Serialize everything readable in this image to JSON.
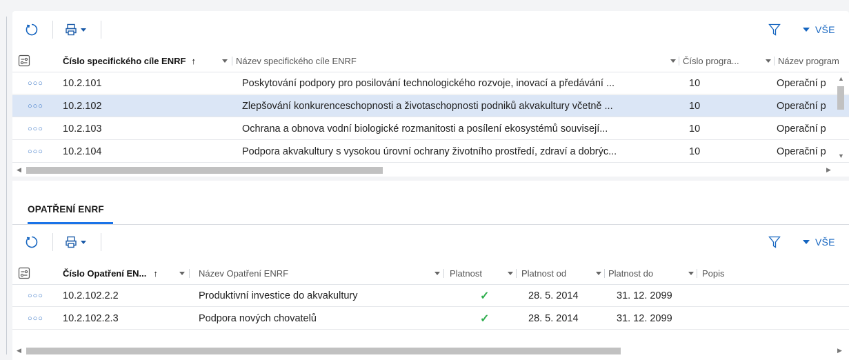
{
  "top_grid": {
    "toolbar": {
      "all_label": "VŠE"
    },
    "columns": [
      {
        "label": "Číslo specifického cíle ENRF",
        "sort_indicator": "↑"
      },
      {
        "label": "Název specifického cíle ENRF"
      },
      {
        "label": "Číslo progra..."
      },
      {
        "label": "Název program"
      }
    ],
    "rows": [
      {
        "code": "10.2.101",
        "name": "Poskytování podpory pro posilování technologického rozvoje, inovací a předávání ...",
        "program": "10",
        "program_name": "Operační p"
      },
      {
        "code": "10.2.102",
        "name": "Zlepšování konkurenceschopnosti a životaschopnosti podniků akvakultury včetně ...",
        "program": "10",
        "program_name": "Operační p",
        "selected": true
      },
      {
        "code": "10.2.103",
        "name": "Ochrana a obnova vodní biologické rozmanitosti a posílení ekosystémů souvisejí...",
        "program": "10",
        "program_name": "Operační p"
      },
      {
        "code": "10.2.104",
        "name": "Podpora akvakultury s vysokou úrovní ochrany životního prostředí, zdraví a dobrýc...",
        "program": "10",
        "program_name": "Operační p"
      }
    ]
  },
  "bottom_panel": {
    "tab_label": "OPATŘENÍ ENRF",
    "toolbar": {
      "all_label": "VŠE"
    },
    "columns": [
      {
        "label": "Číslo Opatření EN...",
        "sort_indicator": "↑"
      },
      {
        "label": "Název Opatření ENRF"
      },
      {
        "label": "Platnost"
      },
      {
        "label": "Platnost od"
      },
      {
        "label": "Platnost do"
      },
      {
        "label": "Popis"
      }
    ],
    "rows": [
      {
        "code": "10.2.102.2.2",
        "name": "Produktivní investice do akvakultury",
        "valid": "✓",
        "valid_from": "28. 5. 2014",
        "valid_to": "31. 12. 2099",
        "desc": ""
      },
      {
        "code": "10.2.102.2.3",
        "name": "Podpora nových chovatelů",
        "valid": "✓",
        "valid_from": "28. 5. 2014",
        "valid_to": "31. 12. 2099",
        "desc": ""
      }
    ]
  },
  "icons": {
    "refresh": "refresh-icon",
    "export": "export-icon",
    "filter": "filter-icon",
    "column_chooser": "column-chooser-icon",
    "row_menu": "row-menu-icon",
    "valid_check": "check-icon"
  },
  "colors": {
    "accent": "#1565c0",
    "selected_row": "#dbe6f6",
    "check": "#2fae4e"
  }
}
